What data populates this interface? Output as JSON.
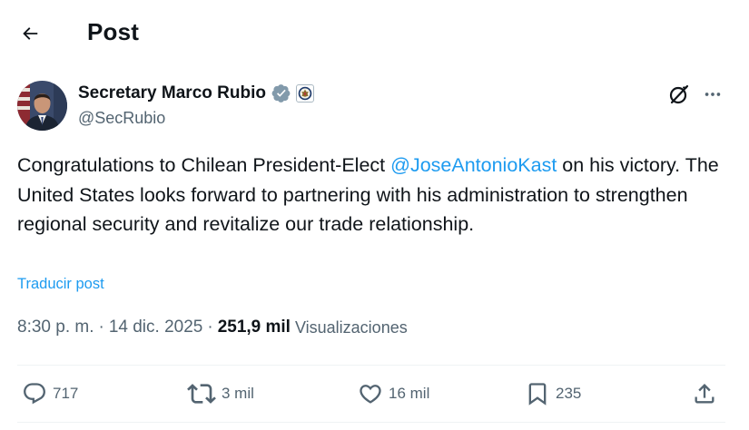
{
  "header": {
    "title": "Post",
    "back_icon": "arrow-left-icon"
  },
  "author": {
    "display_name": "Secretary Marco Rubio",
    "handle": "@SecRubio",
    "verified_icon": "verified-badge-icon",
    "affiliation_icon": "department-seal-icon"
  },
  "post": {
    "text_before": "Congratulations to Chilean President-Elect ",
    "mention": "@JoseAntonioKast",
    "text_after": " on his victory. The United States looks forward to partnering with his administration to strengthen regional security and revitalize our trade relationship.",
    "translate_label": "Traducir post"
  },
  "meta": {
    "time": "8:30 p. m.",
    "separator": "·",
    "date": "14 dic. 2025",
    "views_count": "251,9 mil",
    "views_label": "Visualizaciones"
  },
  "actions": {
    "replies": "717",
    "reposts": "3 mil",
    "likes": "16 mil",
    "bookmarks": "235"
  },
  "colors": {
    "text_primary": "#0f1419",
    "text_secondary": "#536471",
    "accent": "#1d9bf0",
    "divider": "#eff3f4"
  }
}
